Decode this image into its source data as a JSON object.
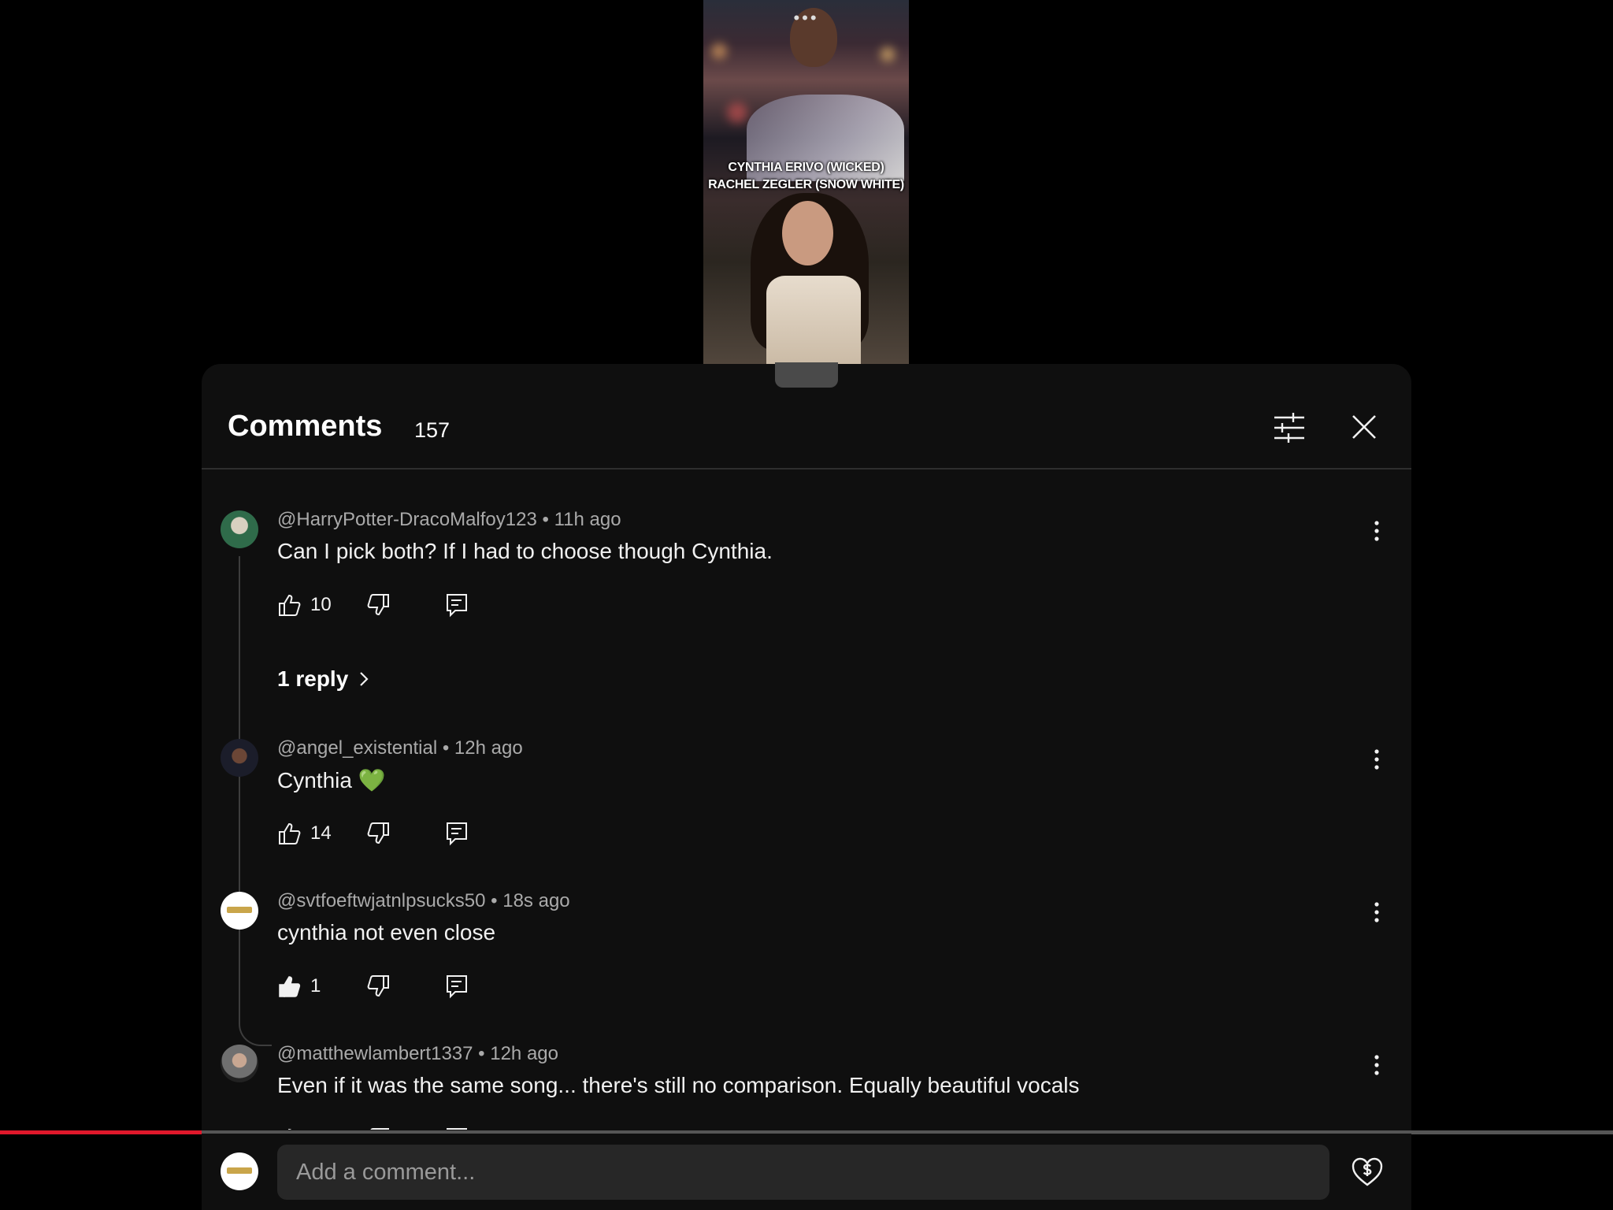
{
  "video": {
    "menu_glyph": "•••",
    "caption_line1": "CYNTHIA ERIVO (WICKED)",
    "caption_line2": "RACHEL ZEGLER (SNOW WHITE)"
  },
  "panel": {
    "title": "Comments",
    "count": "157",
    "filter_icon": "sliders-icon",
    "close_icon": "close-icon"
  },
  "comments": [
    {
      "author": "@HarryPotter-DracoMalfoy123",
      "time": "11h ago",
      "text": "Can I pick both? If I had to choose though Cynthia.",
      "likes": "10",
      "liked": false,
      "replies": "1 reply"
    },
    {
      "author": "@angel_existential",
      "time": "12h ago",
      "text": "Cynthia 💚",
      "likes": "14",
      "liked": false
    },
    {
      "author": "@svtfoeftwjatnlpsucks50",
      "time": "18s ago",
      "text": "cynthia not even close",
      "likes": "1",
      "liked": true
    },
    {
      "author": "@matthewlambert1337",
      "time": "12h ago",
      "text": "Even if it was the same song... there's still no comparison. Equally beautiful vocals",
      "likes": "",
      "liked": false
    }
  ],
  "separator": " • ",
  "composer": {
    "placeholder": "Add a comment...",
    "thanks_icon": "heart-dollar-icon"
  },
  "colors": {
    "progress": "#e0182b",
    "background": "#0f0f0f",
    "input": "#272727"
  },
  "progress_fraction": 0.125
}
